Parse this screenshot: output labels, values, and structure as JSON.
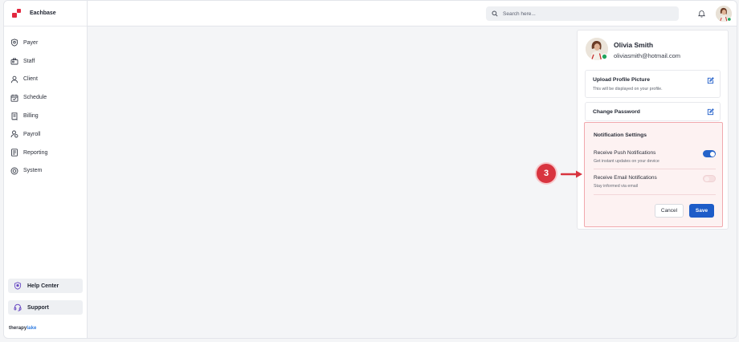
{
  "app": {
    "brand_name": "Eachbase",
    "brand_color": "#e2283f",
    "footer_brand_part1": "therapy",
    "footer_brand_part2": "lake"
  },
  "sidebar": {
    "items": [
      {
        "label": "Payer",
        "icon": "shield-icon"
      },
      {
        "label": "Staff",
        "icon": "staff-icon"
      },
      {
        "label": "Client",
        "icon": "user-icon"
      },
      {
        "label": "Schedule",
        "icon": "calendar-icon"
      },
      {
        "label": "Billing",
        "icon": "billing-icon"
      },
      {
        "label": "Payroll",
        "icon": "payroll-icon"
      },
      {
        "label": "Reporting",
        "icon": "report-icon"
      },
      {
        "label": "System",
        "icon": "system-icon"
      }
    ],
    "help_label": "Help Center",
    "support_label": "Support"
  },
  "topbar": {
    "search_placeholder": "Search here..."
  },
  "profile": {
    "name": "Olivia Smith",
    "email": "oliviasmith@hotmail.com",
    "status_color": "#22a45d",
    "upload_title": "Upload Profile Picture",
    "upload_sub": "This will be displayed on your profile.",
    "password_title": "Change Password"
  },
  "notifications": {
    "title": "Notification Settings",
    "push_title": "Receive Push Notifications",
    "push_sub": "Get instant updates on your device",
    "push_enabled": true,
    "email_title": "Receive Email Notifications",
    "email_sub": "Stay informed via email",
    "email_enabled": false,
    "cancel_label": "Cancel",
    "save_label": "Save",
    "accent_color": "#1d5cc8"
  },
  "annotation": {
    "step_number": "3",
    "color": "#d8343f"
  }
}
